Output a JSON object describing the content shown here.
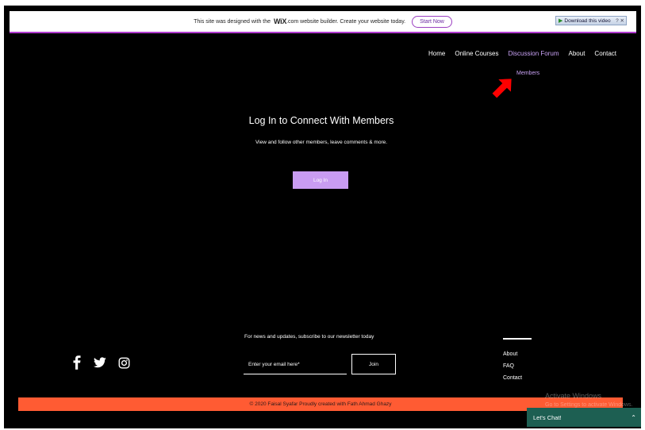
{
  "banner": {
    "text": "This site was designed with the",
    "logo": "WiX",
    "text2": ".com website builder. Create your website today.",
    "start_now": "Start Now"
  },
  "download_video": {
    "label": "Download this video",
    "extra": "? ✕"
  },
  "nav": {
    "items": [
      "Home",
      "Online Courses",
      "Discussion Forum",
      "About",
      "Contact"
    ],
    "active_index": 2,
    "submenu": "Members"
  },
  "main": {
    "title": "Log In to Connect With Members",
    "subtitle": "View and follow other members, leave comments & more.",
    "login_label": "Log In"
  },
  "footer": {
    "newsletter": "For news and updates, subscribe to our newsletter today",
    "email_placeholder": "Enter your email here*",
    "join_label": "Join",
    "links": [
      "About",
      "FAQ",
      "Contact"
    ],
    "social": [
      "facebook-icon",
      "twitter-icon",
      "instagram-icon"
    ],
    "copyright": "© 2020 Faisal Syafar Proudly created with Fath Ahmad Ghazy"
  },
  "watermark": {
    "line1": "Activate Windows",
    "line2": "Go to Settings to activate Windows."
  },
  "chat": {
    "label": "Let's Chat!"
  },
  "colors": {
    "accent": "#c99cf2",
    "copyright_bar": "#ff5b33",
    "chat": "#1d5f52",
    "arrow": "#ff0000"
  }
}
